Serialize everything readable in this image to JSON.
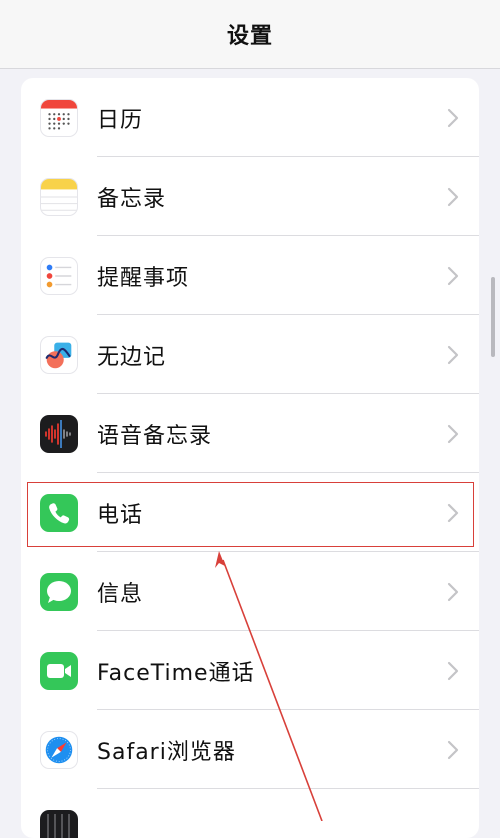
{
  "nav": {
    "title": "设置"
  },
  "rows": [
    {
      "label": "日历",
      "icon": "calendar-icon"
    },
    {
      "label": "备忘录",
      "icon": "notes-icon"
    },
    {
      "label": "提醒事项",
      "icon": "reminders-icon"
    },
    {
      "label": "无边记",
      "icon": "freeform-icon"
    },
    {
      "label": "语音备忘录",
      "icon": "voice-memos-icon"
    },
    {
      "label": "电话",
      "icon": "phone-icon"
    },
    {
      "label": "信息",
      "icon": "messages-icon"
    },
    {
      "label": "FaceTime通话",
      "icon": "facetime-icon"
    },
    {
      "label": "Safari浏览器",
      "icon": "safari-icon"
    },
    {
      "label": "",
      "icon": "stocks-icon"
    }
  ],
  "annotation": {
    "highlighted_item": "电话",
    "color": "#d8403a"
  },
  "colors": {
    "background": "#f2f2f7",
    "phone_green": "#34c759",
    "chevron": "#c4c4c7"
  }
}
